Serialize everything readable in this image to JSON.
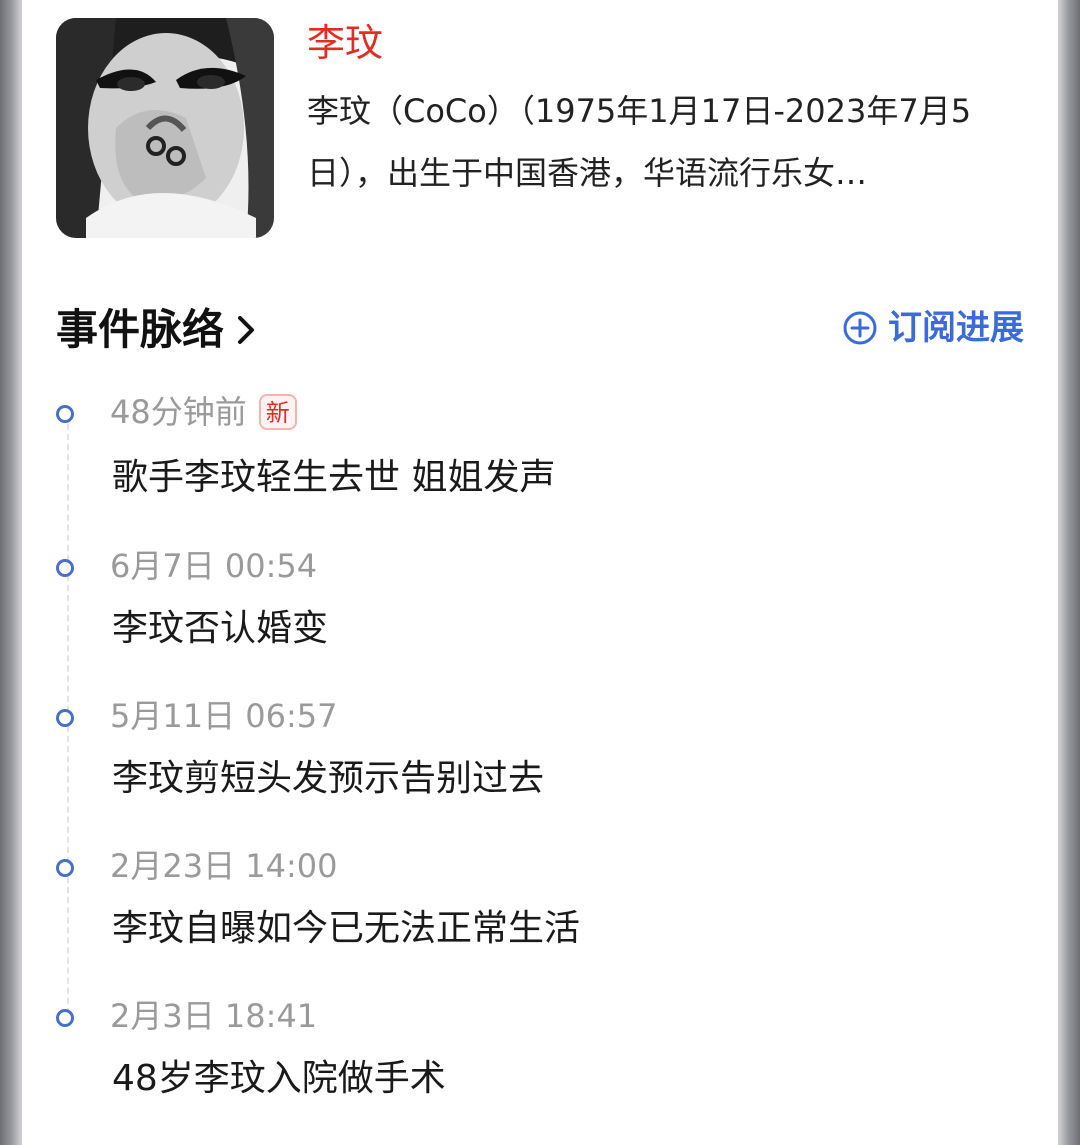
{
  "profile": {
    "name": "李玟",
    "summary": "李玟（CoCo）（1975年1月17日-2023年7月5日），出生于中国香港，华语流行乐女…"
  },
  "section": {
    "title": "事件脉络",
    "subscribe_label": "订阅进展"
  },
  "events": [
    {
      "time": "48分钟前",
      "badge": "新",
      "headline": "歌手李玟轻生去世 姐姐发声"
    },
    {
      "time": "6月7日 00:54",
      "headline": "李玟否认婚变"
    },
    {
      "time": "5月11日 06:57",
      "headline": "李玟剪短头发预示告别过去"
    },
    {
      "time": "2月23日 14:00",
      "headline": "李玟自曝如今已无法正常生活"
    },
    {
      "time": "2月3日 18:41",
      "headline": "48岁李玟入院做手术"
    }
  ],
  "colors": {
    "name_red": "#e02e24",
    "accent_blue": "#3b6ad9",
    "timeline_dot": "#4a6fc7"
  },
  "icons": [
    "chevron-right-icon",
    "plus-circle-icon",
    "timeline-dot-icon"
  ]
}
